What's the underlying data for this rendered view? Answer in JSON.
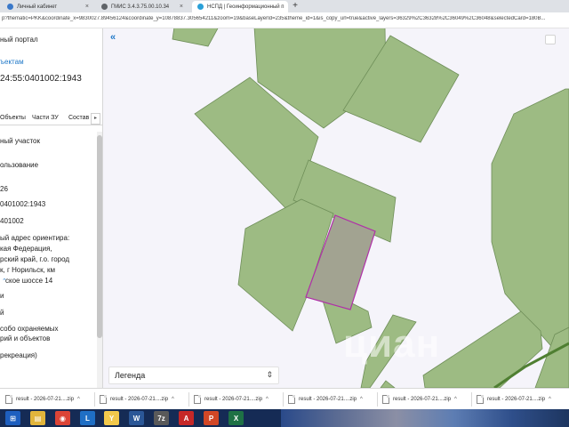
{
  "browser": {
    "tabs": [
      {
        "title": "Личный кабинет",
        "active": false,
        "favicon_color": "#3a78c9"
      },
      {
        "title": "ГМИС 3.4.3.75.00.10.34",
        "active": false,
        "favicon_color": "#5f6368"
      },
      {
        "title": "НСПД | Геоинформационный п",
        "active": true,
        "favicon_color": "#2aa0d8"
      }
    ],
    "new_tab_label": "+",
    "close_label": "×",
    "url": "p?thematic=PKK&coordinate_x=9830027.89456124&coordinate_y=10878837.305654211&zoom=19&baseLayerId=235&theme_id=1&is_copy_url=true&active_layers=36329%2C36328%2C36049%2C36048&selectedCard=180B..."
  },
  "left_panel": {
    "portal_title": "ный портал",
    "to_objects_link": "ъектам",
    "cadastral_number": "24:55:0401002:1943",
    "tabs": [
      "Объекты",
      "Части ЗУ",
      "Состав"
    ],
    "tab_next": "▸",
    "fields": [
      "ный участок",
      "ользование",
      "26",
      "0401002:1943",
      "401002",
      "ый адрес ориентира:",
      "кая Федерация,",
      "рский край, г.о. город",
      "к, г Норильск, км",
      "ское шоссе 14",
      "и",
      "й",
      "собо охраняемых",
      "рий и объектов",
      "рекреация)"
    ],
    "collapse_arrow": "⌃"
  },
  "map": {
    "collapse_button": "«",
    "legend_label": "Легенда",
    "legend_toggle": "⇕",
    "watermark": "циан",
    "colors": {
      "background": "#f5f4fa",
      "parcel_fill": "#9dbb83",
      "parcel_stroke": "#6e8e58",
      "selected_fill": "#a2a391",
      "selected_stroke": "#b02fa8",
      "road": "#4f7f32"
    }
  },
  "downloads": {
    "items": [
      "result - 2026-07-21....zip",
      "result - 2026-07-21....zip",
      "result - 2026-07-21....zip",
      "result - 2026-07-21....zip",
      "result - 2026-07-21....zip",
      "result - 2026-07-21....zip"
    ],
    "chevron": "^"
  },
  "taskbar": {
    "icons": [
      {
        "name": "start-icon",
        "label": "⊞",
        "color": "#1e5fbf"
      },
      {
        "name": "explorer-icon",
        "label": "▤",
        "color": "#e1b53c"
      },
      {
        "name": "chrome-icon",
        "label": "◉",
        "color": "#db4437"
      },
      {
        "name": "lync-icon",
        "label": "L",
        "color": "#1f6fc5"
      },
      {
        "name": "yandex-icon",
        "label": "Y",
        "color": "#f2c94c"
      },
      {
        "name": "word-icon",
        "label": "W",
        "color": "#2b5797"
      },
      {
        "name": "archive-icon",
        "label": "7z",
        "color": "#5a5a5a"
      },
      {
        "name": "pdf-icon",
        "label": "A",
        "color": "#c62828"
      },
      {
        "name": "powerpoint-icon",
        "label": "P",
        "color": "#d24726"
      },
      {
        "name": "excel-icon",
        "label": "X",
        "color": "#1e7145"
      }
    ]
  }
}
